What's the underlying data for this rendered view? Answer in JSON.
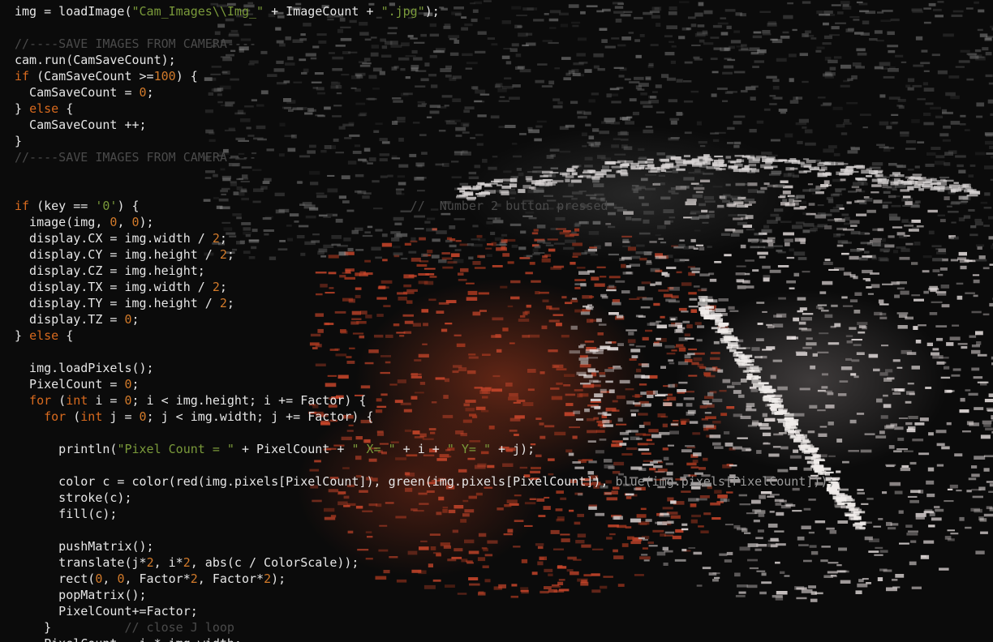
{
  "editor": {
    "lines": [
      {
        "tokens": [
          [
            "fn",
            "img = loadImage("
          ],
          [
            "str",
            "\"Cam_Images\\\\Img_\""
          ],
          [
            "fn",
            " + ImageCount + "
          ],
          [
            "str",
            "\".jpg\""
          ],
          [
            "fn",
            ");"
          ]
        ]
      },
      {
        "tokens": []
      },
      {
        "tokens": [
          [
            "cmt",
            "//----SAVE IMAGES FROM CAMERA----"
          ]
        ]
      },
      {
        "tokens": [
          [
            "fn",
            "cam.run(CamSaveCount);"
          ]
        ]
      },
      {
        "tokens": [
          [
            "kw",
            "if"
          ],
          [
            "fn",
            " (CamSaveCount >="
          ],
          [
            "num",
            "100"
          ],
          [
            "fn",
            ") {"
          ]
        ]
      },
      {
        "tokens": [
          [
            "fn",
            "  CamSaveCount = "
          ],
          [
            "num",
            "0"
          ],
          [
            "fn",
            ";"
          ]
        ]
      },
      {
        "tokens": [
          [
            "fn",
            "} "
          ],
          [
            "kw",
            "else"
          ],
          [
            "fn",
            " {"
          ]
        ]
      },
      {
        "tokens": [
          [
            "fn",
            "  CamSaveCount ++;"
          ]
        ]
      },
      {
        "tokens": [
          [
            "fn",
            "}"
          ]
        ]
      },
      {
        "tokens": [
          [
            "cmt",
            "//----SAVE IMAGES FROM CAMERA----"
          ]
        ]
      },
      {
        "tokens": []
      },
      {
        "tokens": []
      },
      {
        "tokens": [
          [
            "kw",
            "if"
          ],
          [
            "fn",
            " (key == "
          ],
          [
            "str",
            "'0'"
          ],
          [
            "fn",
            ") {                                     "
          ],
          [
            "cmt",
            "//  Number 2 button pressed"
          ]
        ]
      },
      {
        "tokens": [
          [
            "fn",
            "  image(img, "
          ],
          [
            "num",
            "0"
          ],
          [
            "fn",
            ", "
          ],
          [
            "num",
            "0"
          ],
          [
            "fn",
            ");"
          ]
        ]
      },
      {
        "tokens": [
          [
            "fn",
            "  display.CX = img.width / "
          ],
          [
            "num",
            "2"
          ],
          [
            "fn",
            ";"
          ]
        ]
      },
      {
        "tokens": [
          [
            "fn",
            "  display.CY = img.height / "
          ],
          [
            "num",
            "2"
          ],
          [
            "fn",
            ";"
          ]
        ]
      },
      {
        "tokens": [
          [
            "fn",
            "  display.CZ = img.height;"
          ]
        ]
      },
      {
        "tokens": [
          [
            "fn",
            "  display.TX = img.width / "
          ],
          [
            "num",
            "2"
          ],
          [
            "fn",
            ";"
          ]
        ]
      },
      {
        "tokens": [
          [
            "fn",
            "  display.TY = img.height / "
          ],
          [
            "num",
            "2"
          ],
          [
            "fn",
            ";"
          ]
        ]
      },
      {
        "tokens": [
          [
            "fn",
            "  display.TZ = "
          ],
          [
            "num",
            "0"
          ],
          [
            "fn",
            ";"
          ]
        ]
      },
      {
        "tokens": [
          [
            "fn",
            "} "
          ],
          [
            "kw",
            "else"
          ],
          [
            "fn",
            " {"
          ]
        ]
      },
      {
        "tokens": []
      },
      {
        "tokens": [
          [
            "fn",
            "  img.loadPixels();"
          ]
        ]
      },
      {
        "tokens": [
          [
            "fn",
            "  PixelCount = "
          ],
          [
            "num",
            "0"
          ],
          [
            "fn",
            ";"
          ]
        ]
      },
      {
        "tokens": [
          [
            "kw",
            "  for"
          ],
          [
            "fn",
            " ("
          ],
          [
            "kw",
            "int"
          ],
          [
            "fn",
            " i = "
          ],
          [
            "num",
            "0"
          ],
          [
            "fn",
            "; i < img.height; i += Factor) {"
          ]
        ]
      },
      {
        "tokens": [
          [
            "kw",
            "    for"
          ],
          [
            "fn",
            " ("
          ],
          [
            "kw",
            "int"
          ],
          [
            "fn",
            " j = "
          ],
          [
            "num",
            "0"
          ],
          [
            "fn",
            "; j < img.width; j += Factor) {"
          ]
        ]
      },
      {
        "tokens": []
      },
      {
        "tokens": [
          [
            "fn",
            "      println("
          ],
          [
            "str",
            "\"Pixel Count = \""
          ],
          [
            "fn",
            " + PixelCount + "
          ],
          [
            "str",
            "\" X= \""
          ],
          [
            "fn",
            " + i + "
          ],
          [
            "str",
            "\" Y= \""
          ],
          [
            "fn",
            " + j);"
          ]
        ]
      },
      {
        "tokens": []
      },
      {
        "tokens": [
          [
            "fn",
            "      color c = color(red(img.pixels[PixelCount]), green(img.pixels[PixelCount]), "
          ],
          [
            "dim",
            "blue(img.pixels[PixelCount]));"
          ]
        ]
      },
      {
        "tokens": [
          [
            "fn",
            "      stroke(c);"
          ]
        ]
      },
      {
        "tokens": [
          [
            "fn",
            "      fill(c);"
          ]
        ]
      },
      {
        "tokens": []
      },
      {
        "tokens": [
          [
            "fn",
            "      pushMatrix();"
          ]
        ]
      },
      {
        "tokens": [
          [
            "fn",
            "      translate(j*"
          ],
          [
            "num",
            "2"
          ],
          [
            "fn",
            ", i*"
          ],
          [
            "num",
            "2"
          ],
          [
            "fn",
            ", abs(c / ColorScale));"
          ]
        ]
      },
      {
        "tokens": [
          [
            "fn",
            "      rect("
          ],
          [
            "num",
            "0"
          ],
          [
            "fn",
            ", "
          ],
          [
            "num",
            "0"
          ],
          [
            "fn",
            ", Factor*"
          ],
          [
            "num",
            "2"
          ],
          [
            "fn",
            ", Factor*"
          ],
          [
            "num",
            "2"
          ],
          [
            "fn",
            ");"
          ]
        ]
      },
      {
        "tokens": [
          [
            "fn",
            "      popMatrix();"
          ]
        ]
      },
      {
        "tokens": [
          [
            "fn",
            "      PixelCount+=Factor;"
          ]
        ]
      },
      {
        "tokens": [
          [
            "fn",
            "    }          "
          ],
          [
            "cmt",
            "// close J loop"
          ]
        ]
      },
      {
        "tokens": [
          [
            "fn",
            "    PixelCount = i * img.width;"
          ]
        ]
      }
    ]
  },
  "background": {
    "description_colors": {
      "orange": "#c8472a",
      "white": "#e8e2e0",
      "gray": "#8a8a8a"
    }
  }
}
